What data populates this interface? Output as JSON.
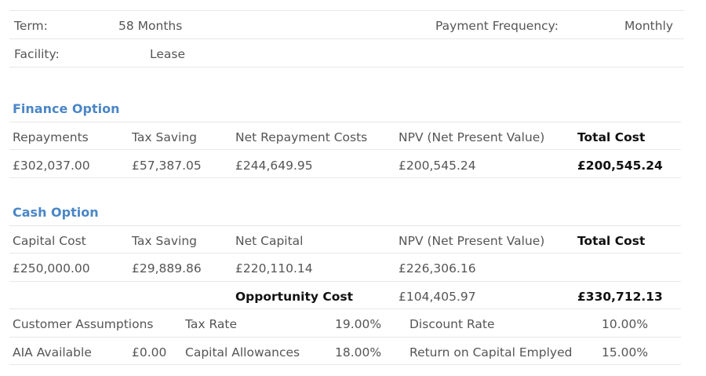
{
  "term_row": {
    "term_label": "Term:",
    "term_value": "58 Months",
    "freq_label": "Payment Frequency:",
    "freq_value": "Monthly"
  },
  "facility_row": {
    "facility_label": "Facility:",
    "facility_value": "Lease"
  },
  "finance": {
    "title": "Finance Option",
    "headers": [
      "Repayments",
      "Tax Saving",
      "Net Repayment Costs",
      "NPV (Net Present Value)",
      "Total Cost"
    ],
    "values": [
      "£302,037.00",
      "£57,387.05",
      "£244,649.95",
      "£200,545.24",
      "£200,545.24"
    ]
  },
  "cash": {
    "title": "Cash Option",
    "headers": [
      "Capital Cost",
      "Tax Saving",
      "Net Capital",
      "NPV (Net Present Value)",
      "Total Cost"
    ],
    "values": [
      "£250,000.00",
      "£29,889.86",
      "£220,110.14",
      "£226,306.16"
    ],
    "opportunity_label": "Opportunity Cost",
    "opportunity_value": "£104,405.97",
    "opportunity_total": "£330,712.13"
  },
  "assumptions": {
    "label": "Customer Assumptions",
    "tax_rate_label": "Tax Rate",
    "tax_rate_value": "19.00%",
    "discount_rate_label": "Discount Rate",
    "discount_rate_value": "10.00%",
    "aia_label": "AIA Available",
    "aia_value": "£0.00",
    "capital_allowances_label": "Capital Allowances",
    "capital_allowances_value": "18.00%",
    "roce_label": "Return on Capital Emplyed",
    "roce_value": "15.00%"
  }
}
